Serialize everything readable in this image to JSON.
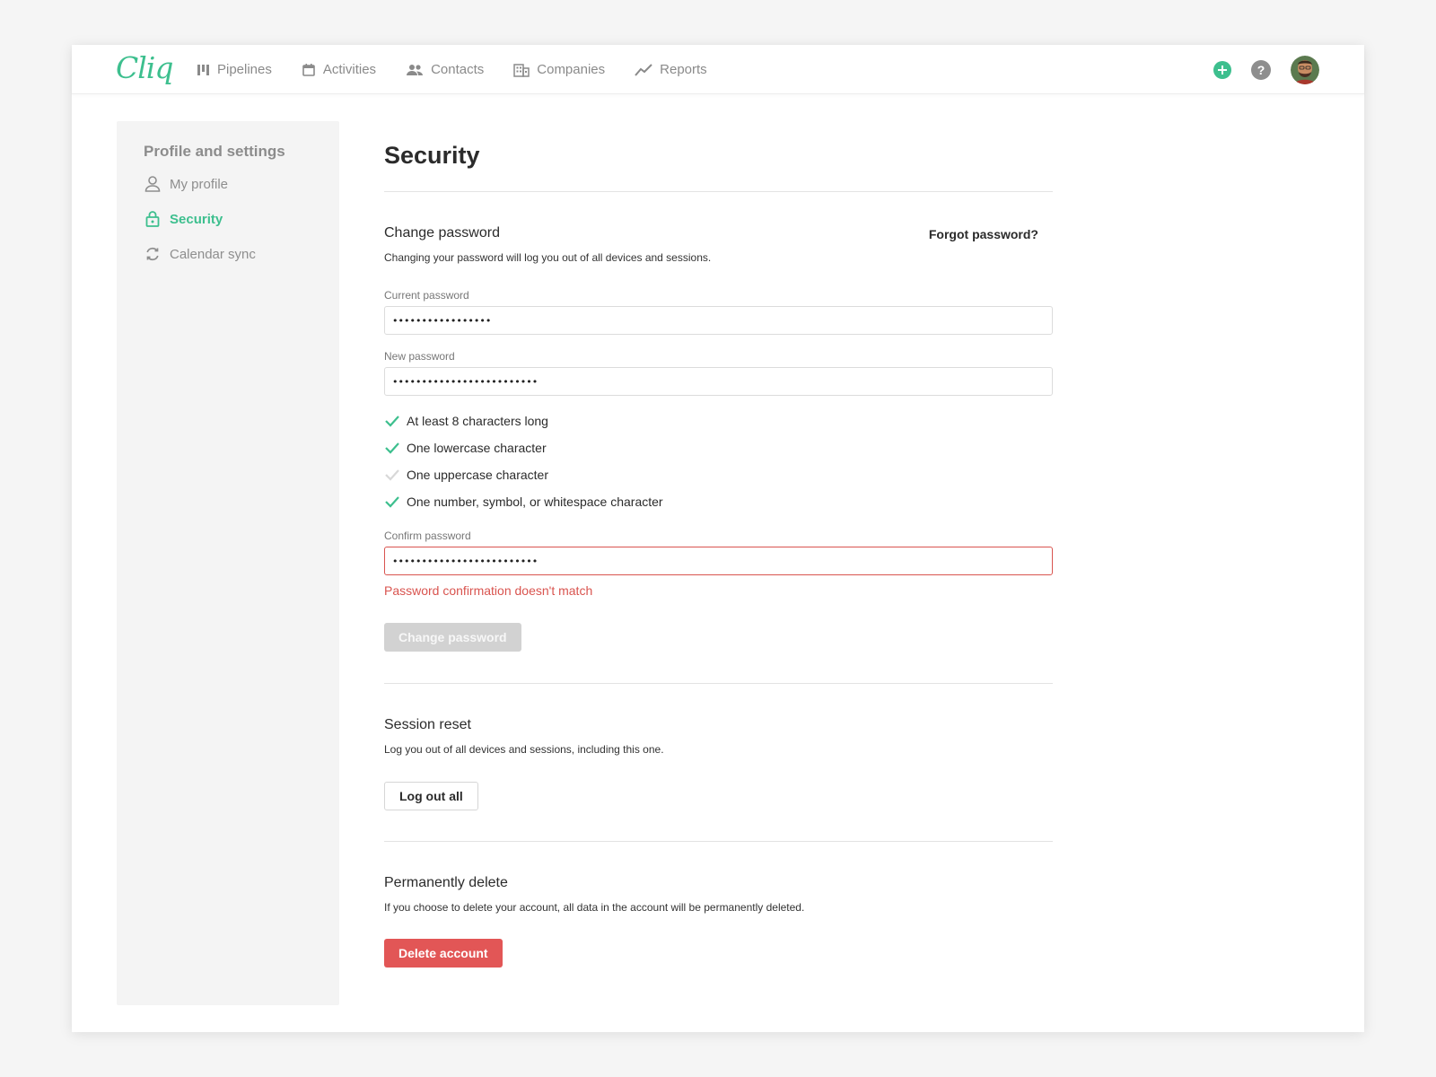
{
  "app": {
    "logo": "Cliq",
    "accent_color": "#3dbf8e",
    "danger_color": "#d9544f"
  },
  "nav": {
    "items": [
      {
        "label": "Pipelines",
        "icon": "pipeline-icon"
      },
      {
        "label": "Activities",
        "icon": "calendar-icon"
      },
      {
        "label": "Contacts",
        "icon": "people-icon"
      },
      {
        "label": "Companies",
        "icon": "building-icon"
      },
      {
        "label": "Reports",
        "icon": "trend-icon"
      }
    ],
    "actions": [
      {
        "icon": "add-circle-icon"
      },
      {
        "icon": "help-icon"
      },
      {
        "icon": "avatar"
      }
    ]
  },
  "sidebar": {
    "title": "Profile and settings",
    "items": [
      {
        "label": "My profile",
        "icon": "user-icon",
        "active": false
      },
      {
        "label": "Security",
        "icon": "lock-icon",
        "active": true
      },
      {
        "label": "Calendar sync",
        "icon": "sync-icon",
        "active": false
      }
    ]
  },
  "main": {
    "title": "Security",
    "change_password": {
      "title": "Change password",
      "description": "Changing your password will log you out of all devices and sessions.",
      "forgot_link": "Forgot password?",
      "current_label": "Current password",
      "current_value": "•••••••••••••••••",
      "new_label": "New password",
      "new_value": "•••••••••••••••••••••••••",
      "rules": [
        {
          "label": "At least 8 characters long",
          "met": true
        },
        {
          "label": "One lowercase character",
          "met": true
        },
        {
          "label": "One uppercase character",
          "met": false
        },
        {
          "label": "One number, symbol, or whitespace character",
          "met": true
        }
      ],
      "confirm_label": "Confirm password",
      "confirm_value": "•••••••••••••••••••••••••",
      "error": "Password confirmation doesn't match",
      "submit_label": "Change password"
    },
    "session_reset": {
      "title": "Session reset",
      "description": "Log you out of all devices and sessions, including this one.",
      "button_label": "Log out all"
    },
    "delete": {
      "title": "Permanently delete",
      "description": "If you choose to delete your account, all data in the account will be permanently deleted.",
      "button_label": "Delete account"
    }
  }
}
